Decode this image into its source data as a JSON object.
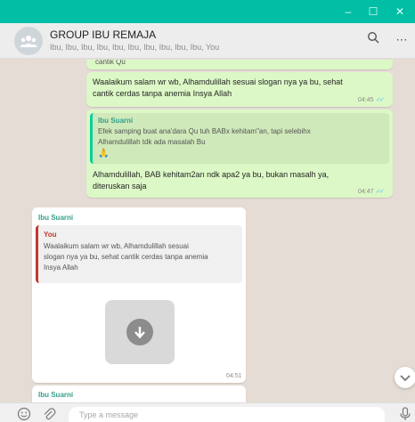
{
  "window": {
    "minimize_symbol": "–",
    "maximize_symbol": "☐",
    "close_symbol": "✕",
    "titlebar_color": "#00bfa5"
  },
  "header": {
    "group_name": "GROUP IBU REMAJA",
    "members": "Ibu, Ibu, Ibu, Ibu, Ibu, Ibu, Ibu, Ibu, Ibu, Ibu, You",
    "search_icon": "search-icon",
    "menu_symbol": "⋯"
  },
  "messages": [
    {
      "type": "outgoing",
      "partial_text": "cantik Qu",
      "has_image_thumbnail": true
    },
    {
      "type": "outgoing",
      "text_line1": "Waalaikum salam wr wb, Alhamdulillah sesuai slogan nya ya bu,  sehat",
      "text_line2": "cantik cerdas tanpa anemia Insya Allah",
      "time": "04:45"
    },
    {
      "type": "outgoing",
      "quote_author": "Ibu Suarni",
      "quote_line1": "Efek samping buat ana'dara Qu tuh BABx kehitam\"an, tapi selebihx",
      "quote_line2": "Alhamdulillah tdk ada masalah Bu",
      "quote_emoji": "🙏",
      "text_line1": "Alhamdulillah, BAB kehitam2an ndk apa2 ya bu, bukan masalh ya,",
      "text_line2": "diteruskan saja",
      "time": "04:47"
    },
    {
      "type": "incoming",
      "sender": "Ibu Suarni",
      "quote_author": "You",
      "quote_line1": "Waalaikum salam wr wb, Alhamdulillah sesuai",
      "quote_line2": "slogan nya ya bu,  sehat cantik cerdas tanpa anemia",
      "quote_line3": "Insya Allah",
      "attachment_icon": "download-icon",
      "time": "04:51"
    },
    {
      "type": "incoming",
      "sender": "Ibu Suarni"
    }
  ],
  "scroll_down_icon": "chevron-down-icon",
  "composer": {
    "emoji_icon": "emoji-icon",
    "attach_icon": "paperclip-icon",
    "placeholder": "Type a message",
    "mic_icon": "microphone-icon"
  },
  "colors": {
    "outgoing_bubble": "#dcf8c6",
    "incoming_bubble": "#ffffff",
    "chat_background": "#e5ddd5",
    "read_ticks": "#4fc3f7",
    "sender_name": "#35a08a"
  }
}
